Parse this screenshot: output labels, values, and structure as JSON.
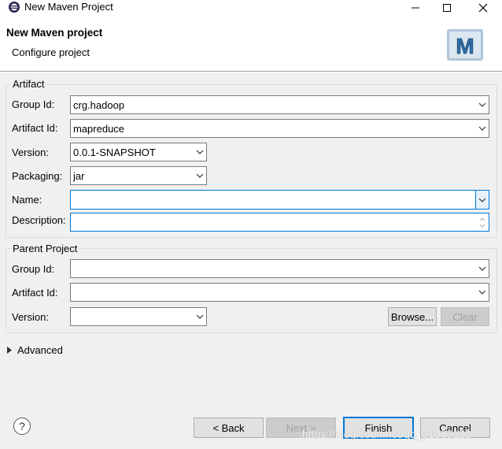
{
  "window": {
    "title": "New Maven Project"
  },
  "header": {
    "title": "New Maven project",
    "description": "Configure project"
  },
  "artifact": {
    "group_title": "Artifact",
    "group_id_label": "Group Id:",
    "group_id_value": "crg.hadoop",
    "artifact_id_label": "Artifact Id:",
    "artifact_id_value": "mapreduce",
    "version_label": "Version:",
    "version_value": "0.0.1-SNAPSHOT",
    "packaging_label": "Packaging:",
    "packaging_value": "jar",
    "name_label": "Name:",
    "name_value": "",
    "description_label": "Description:",
    "description_value": ""
  },
  "parent": {
    "group_title": "Parent Project",
    "group_id_label": "Group Id:",
    "group_id_value": "",
    "artifact_id_label": "Artifact Id:",
    "artifact_id_value": "",
    "version_label": "Version:",
    "version_value": "",
    "browse_label": "Browse...",
    "clear_label": "Clear"
  },
  "advanced": {
    "label": "Advanced"
  },
  "footer": {
    "help_glyph": "?",
    "back_label": "< Back",
    "next_label": "Next >",
    "finish_label": "Finish",
    "cancel_label": "Cancel"
  },
  "watermark": "https://blog.csdn.net/qq_31083123",
  "colors": {
    "focus": "#0078d7",
    "background": "#f0f0f0"
  }
}
